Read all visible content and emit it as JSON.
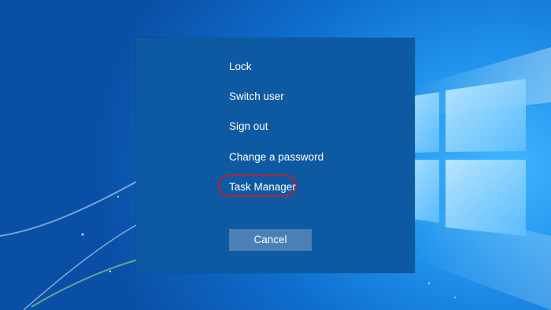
{
  "security_options": {
    "items": [
      {
        "label": "Lock"
      },
      {
        "label": "Switch user"
      },
      {
        "label": "Sign out"
      },
      {
        "label": "Change a password"
      },
      {
        "label": "Task Manager"
      }
    ],
    "highlighted_item": "Task Manager",
    "cancel_label": "Cancel"
  },
  "colors": {
    "dialog_background": "#0d5aa3",
    "button_background": "#4b7fb6",
    "highlight_ring": "#c01f2d",
    "text": "#ffffff"
  }
}
